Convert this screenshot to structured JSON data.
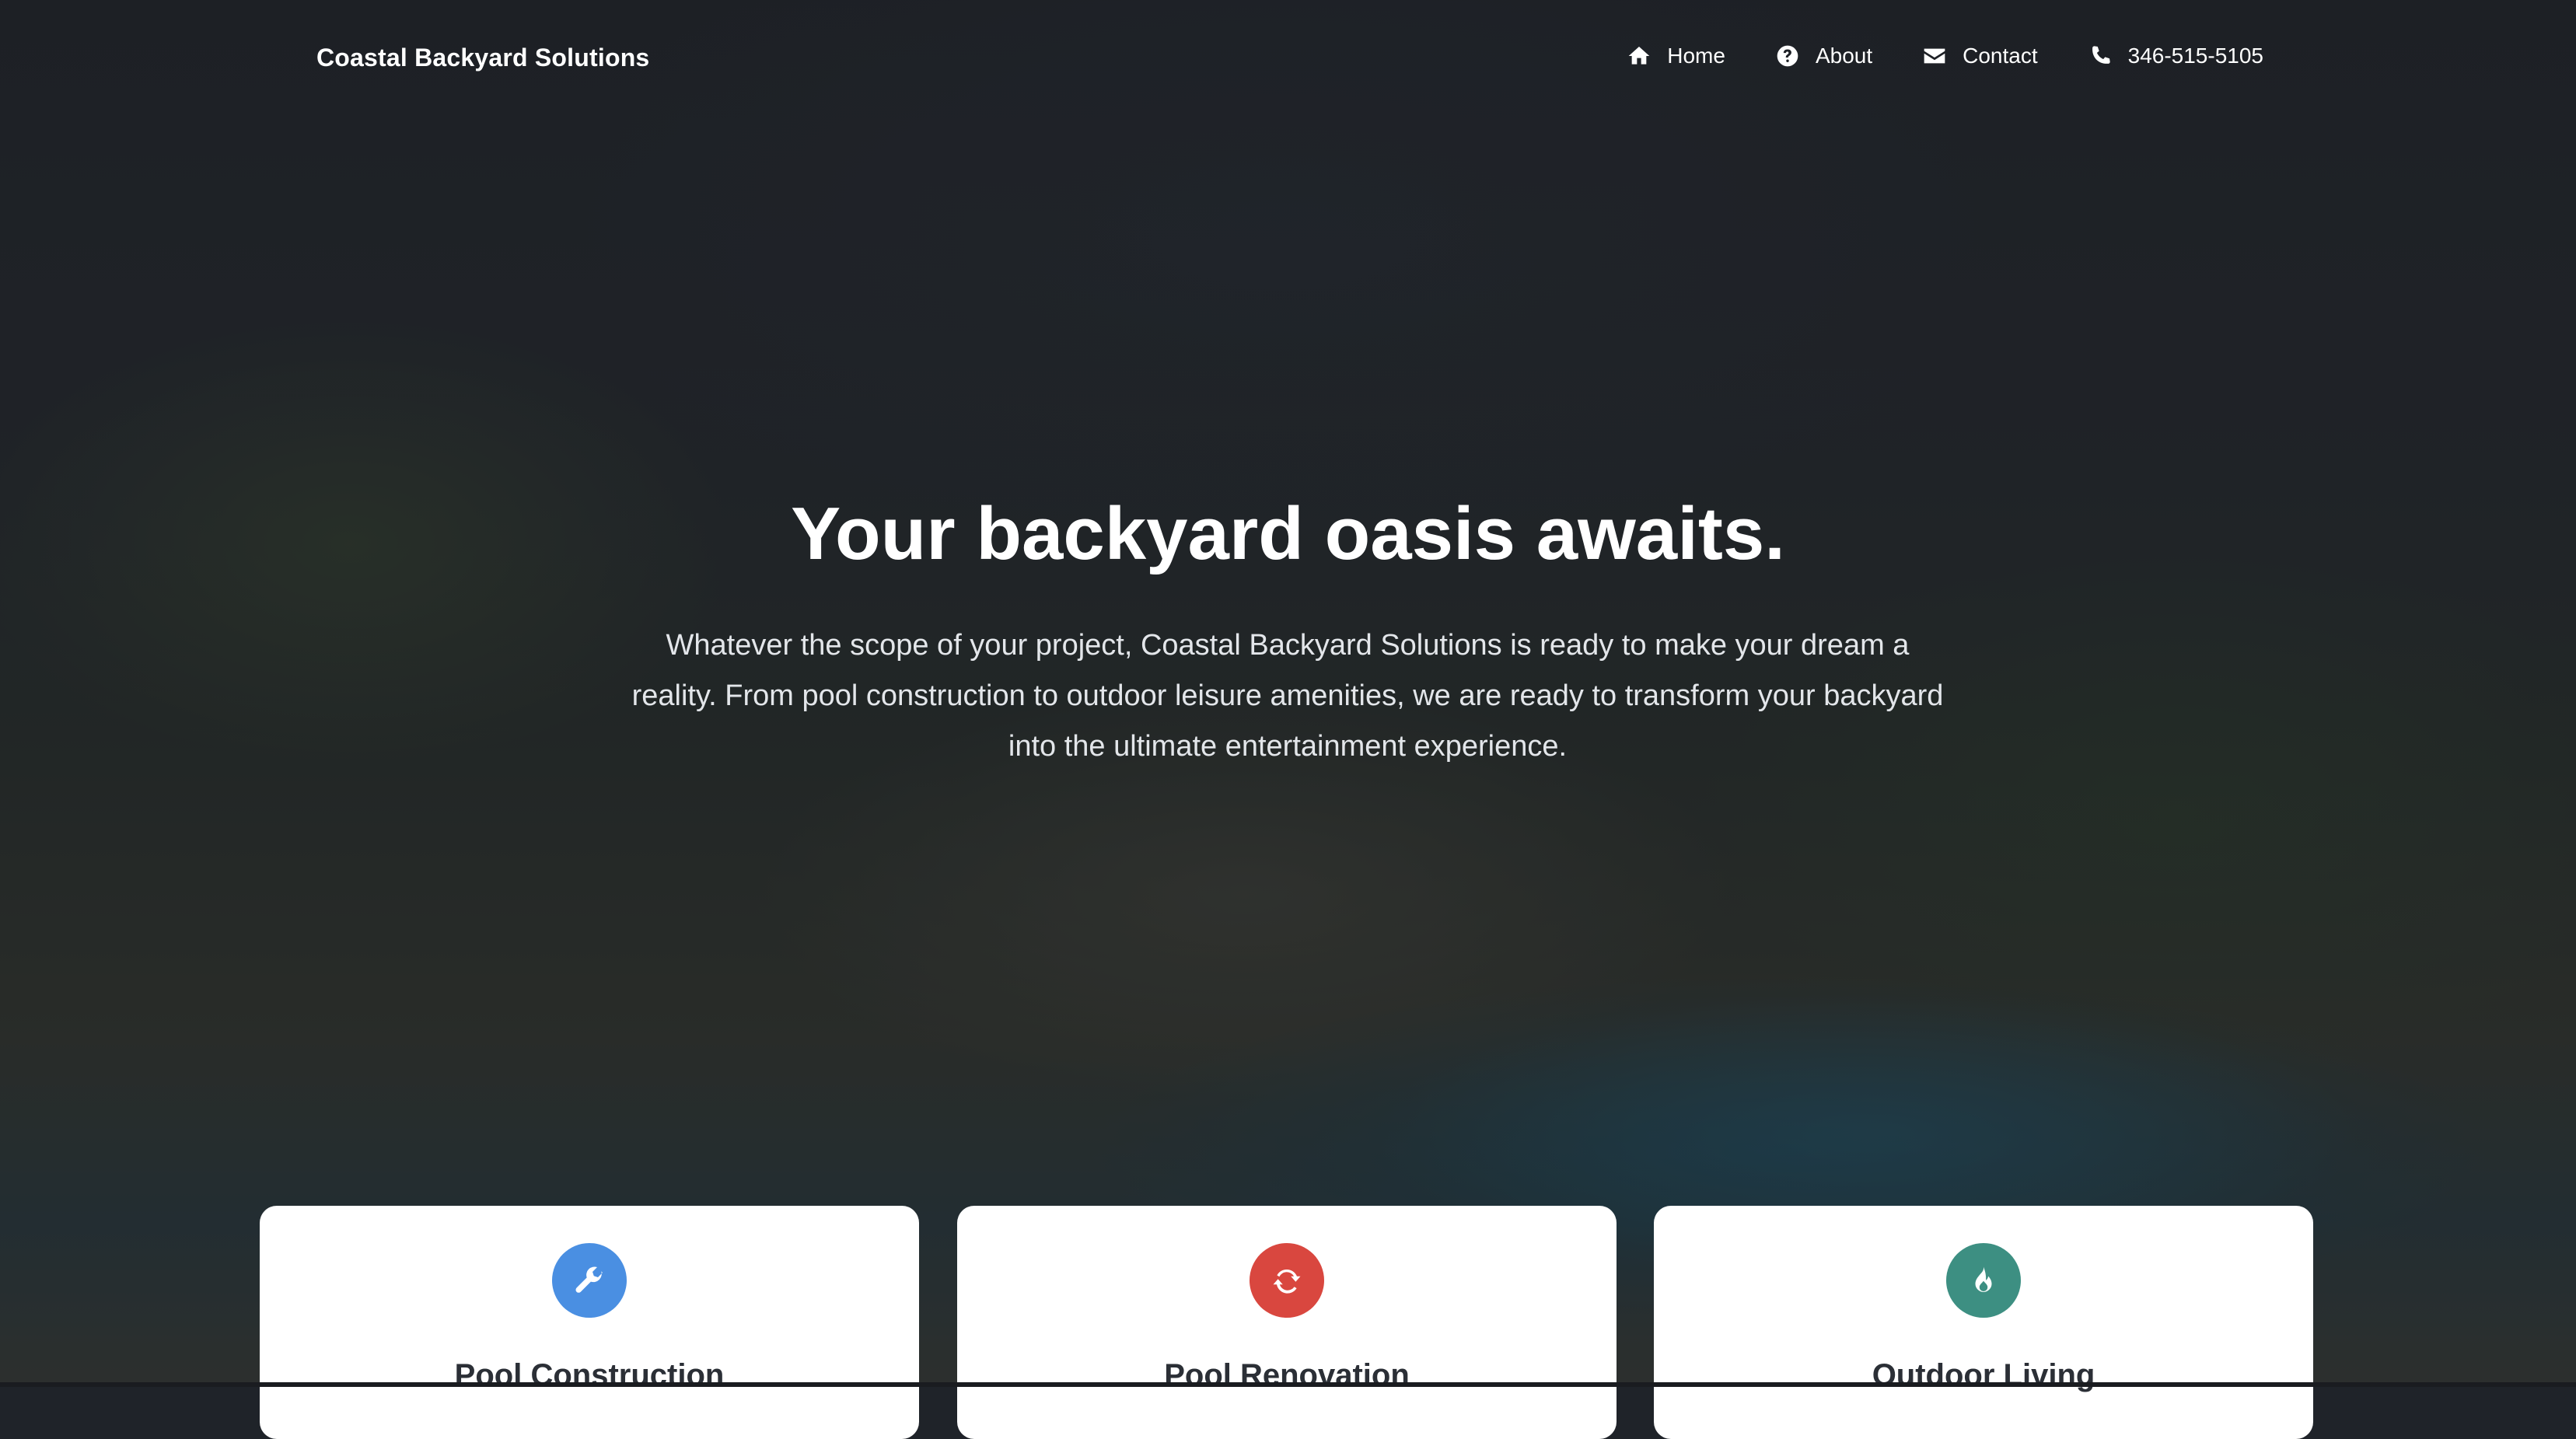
{
  "nav": {
    "brand": "Coastal Backyard Solutions",
    "links": [
      {
        "label": "Home",
        "icon": "home-icon"
      },
      {
        "label": "About",
        "icon": "question-circle-icon"
      },
      {
        "label": "Contact",
        "icon": "envelope-icon"
      },
      {
        "label": "346-515-5105",
        "icon": "phone-icon"
      }
    ]
  },
  "hero": {
    "title": "Your backyard oasis awaits.",
    "text": "Whatever the scope of your project, Coastal Backyard Solutions is ready to make your dream a reality. From pool construction to outdoor leisure amenities, we are ready to transform your backyard into the ultimate entertainment experience."
  },
  "services": [
    {
      "title": "Pool Construction",
      "icon": "wrench-icon",
      "color": "#4a8fe2"
    },
    {
      "title": "Pool Renovation",
      "icon": "refresh-icon",
      "color": "#d9473f"
    },
    {
      "title": "Outdoor Living",
      "icon": "fire-icon",
      "color": "#3d8f82"
    }
  ]
}
